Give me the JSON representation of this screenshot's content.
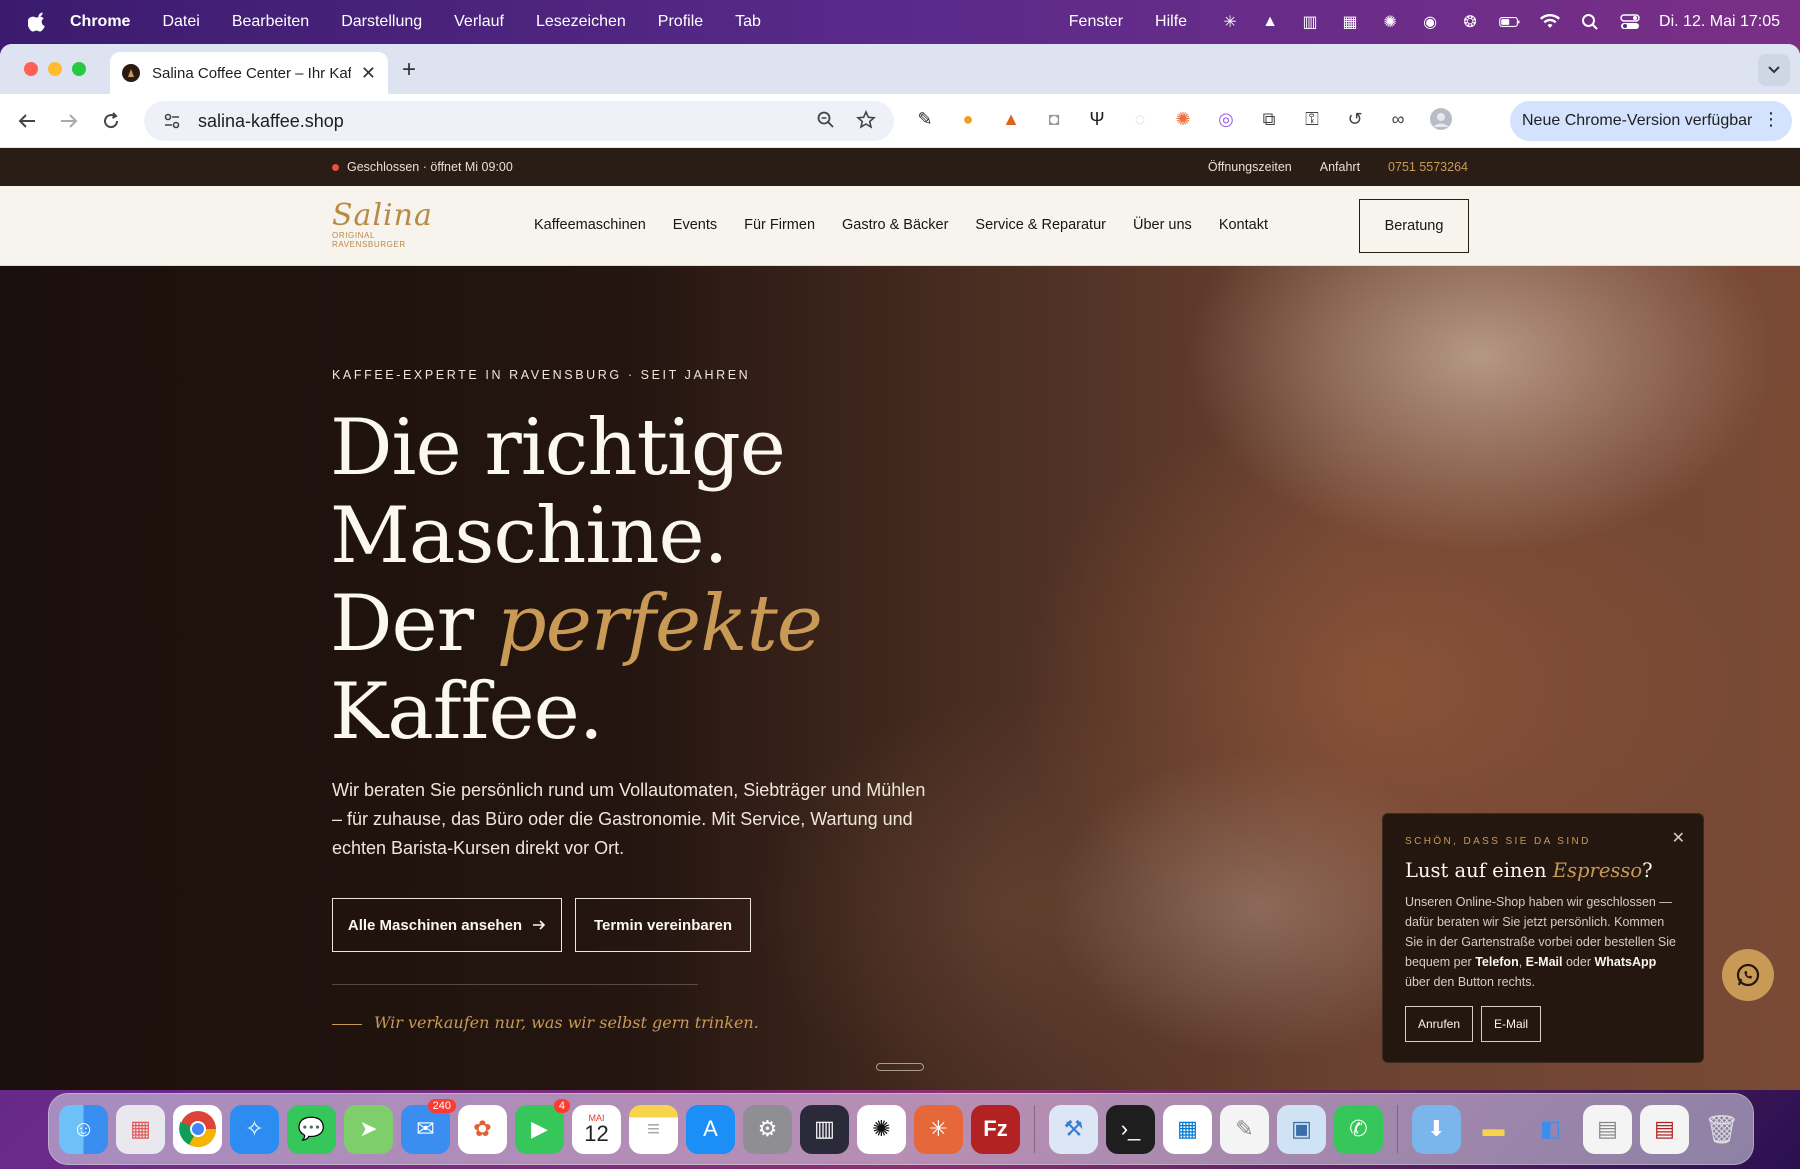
{
  "menubar": {
    "app": "Chrome",
    "items": [
      "Datei",
      "Bearbeiten",
      "Darstellung",
      "Verlauf",
      "Lesezeichen",
      "Profile",
      "Tab"
    ],
    "right_items": [
      "Fenster",
      "Hilfe"
    ],
    "clock": "Di. 12. Mai  17:05"
  },
  "browser": {
    "tab_title": "Salina Coffee Center – Ihr Kaf",
    "url": "salina-kaffee.shop",
    "update_label": "Neue Chrome-Version verfügbar"
  },
  "site": {
    "topbar": {
      "status": "Geschlossen · öffnet Mi 09:00",
      "links": [
        "Öffnungszeiten",
        "Anfahrt"
      ],
      "phone": "0751 5573264"
    },
    "logo": {
      "name": "Salina",
      "tagline": "ORIGINAL RAVENSBURGER"
    },
    "nav": [
      "Kaffeemaschinen",
      "Events",
      "Für Firmen",
      "Gastro & Bäcker",
      "Service & Reparatur",
      "Über uns",
      "Kontakt"
    ],
    "consult_button": "Beratung",
    "hero": {
      "kicker": "KAFFEE-EXPERTE IN RAVENSBURG · SEIT JAHREN",
      "headline_line1": "Die richtige",
      "headline_line2": "Maschine.",
      "headline_line3_pre": "Der ",
      "headline_line3_accent": "perfekte",
      "headline_line4": "Kaffee.",
      "lead": "Wir beraten Sie persönlich rund um Vollautomaten, Siebträger und Mühlen – für zuhause, das Büro oder die Gastronomie. Mit Service, Wartung und echten Barista-Kursen direkt vor Ort.",
      "primary_button": "Alle Maschinen ansehen",
      "secondary_button": "Termin vereinbaren",
      "quote": "Wir verkaufen nur, was wir selbst gern trinken."
    },
    "popup": {
      "eyebrow": "SCHÖN, DASS SIE DA SIND",
      "title_pre": "Lust auf einen ",
      "title_em": "Espresso",
      "title_post": "?",
      "body_1": "Unseren Online-Shop haben wir geschlossen — dafür beraten wir Sie jetzt persönlich. Kommen Sie in der Gartenstraße vorbei oder bestellen Sie bequem per ",
      "body_b1": "Telefon",
      "body_2": ", ",
      "body_b2": "E-Mail",
      "body_3": " oder ",
      "body_b3": "WhatsApp",
      "body_4": " über den Button rechts.",
      "call": "Anrufen",
      "email": "E-Mail"
    }
  },
  "dock": {
    "badges": {
      "mail": "240",
      "facetime": "4"
    },
    "calendar_month": "MAI",
    "calendar_day": "12"
  },
  "colors": {
    "accent_gold": "#c89a55",
    "dark_brown": "#2a1d16",
    "cream": "#f7f3ed"
  }
}
